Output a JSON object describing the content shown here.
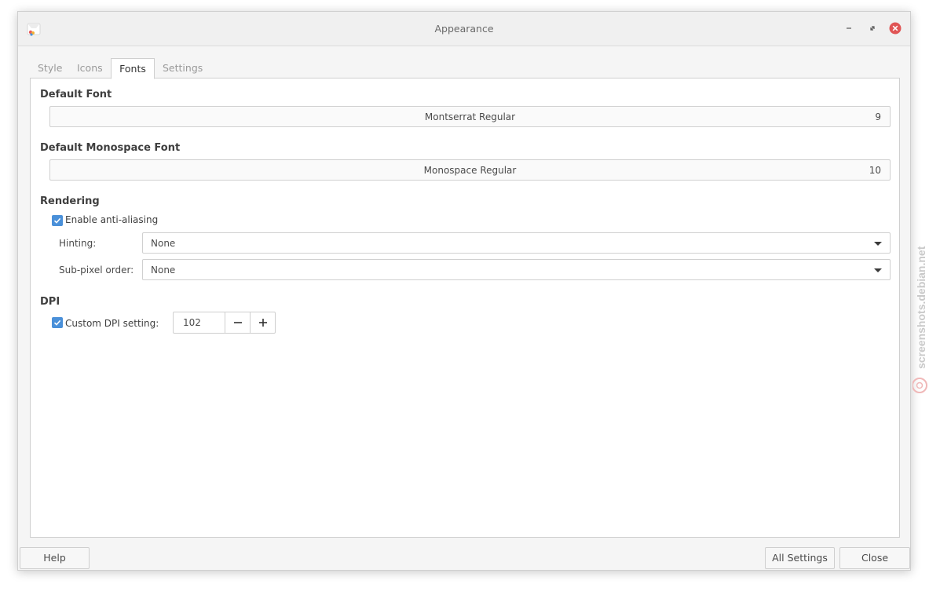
{
  "window": {
    "title": "Appearance",
    "buttons": [
      "minimize",
      "maximize",
      "close"
    ]
  },
  "tabs": [
    {
      "label": "Style",
      "active": false
    },
    {
      "label": "Icons",
      "active": false
    },
    {
      "label": "Fonts",
      "active": true
    },
    {
      "label": "Settings",
      "active": false
    }
  ],
  "fonts": {
    "default_title": "Default Font",
    "default_name": "Montserrat Regular",
    "default_size": "9",
    "mono_title": "Default Monospace Font",
    "mono_name": "Monospace Regular",
    "mono_size": "10"
  },
  "rendering": {
    "title": "Rendering",
    "antialias_label": "Enable anti-aliasing",
    "antialias_checked": true,
    "hinting_label": "Hinting:",
    "hinting_value": "None",
    "subpixel_label": "Sub-pixel order:",
    "subpixel_value": "None"
  },
  "dpi": {
    "title": "DPI",
    "custom_label": "Custom DPI setting:",
    "custom_checked": true,
    "value": "102"
  },
  "footer": {
    "help": "Help",
    "all_settings": "All Settings",
    "close": "Close"
  },
  "watermark": "screenshots.debian.net",
  "colors": {
    "accent": "#4a90d9",
    "close_button": "#e05555"
  }
}
